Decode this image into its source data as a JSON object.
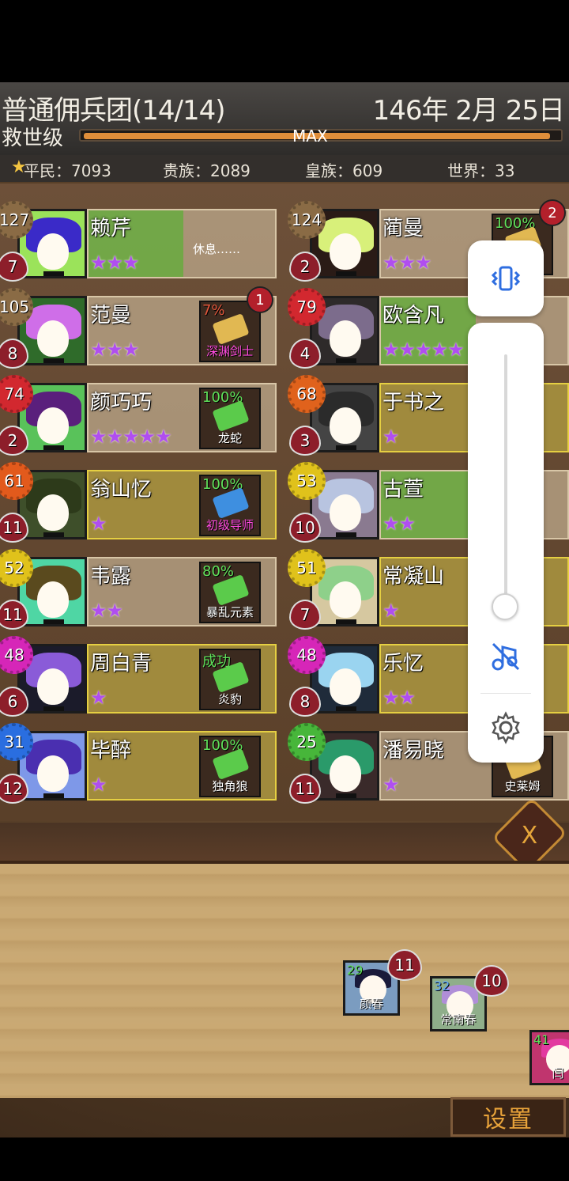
{
  "header": {
    "title": "普通佣兵团(14/14)",
    "date": "146年 2月 25日",
    "rank": "救世级",
    "xp_label": "MAX",
    "xp_fraction": 1.0
  },
  "stats": {
    "commoner": "平民：7093",
    "noble": "贵族：2089",
    "royal": "皇族：609",
    "world": "世界：33"
  },
  "roster_left": [
    {
      "name": "赖芹",
      "level": "127",
      "hp": "7",
      "stars": "★★★",
      "item": "",
      "item_pct": "",
      "rest": "休息……",
      "lvl_color": "#8a6b45",
      "hair": "#3a2ac8",
      "bg": "#9be35a",
      "highlight": true
    },
    {
      "name": "范曼",
      "level": "105",
      "hp": "8",
      "stars": "★★★",
      "item": "深渊剑士",
      "item_pct": "7%",
      "badge": "1",
      "lvl_color": "#8a6b45",
      "hair": "#cf6ee8",
      "bg": "#2f6b2a",
      "item_magenta": true
    },
    {
      "name": "颜巧巧",
      "level": "74",
      "hp": "2",
      "stars": "★★★★★",
      "item": "龙蛇",
      "item_pct": "100%",
      "lvl_color": "#d2282f",
      "hair": "#5a1f7c",
      "bg": "#59c25a"
    },
    {
      "name": "翁山忆",
      "level": "61",
      "hp": "11",
      "stars": "★",
      "item": "初级导师",
      "item_pct": "100%",
      "lvl_color": "#e25a1c",
      "hair": "#2d3a1a",
      "bg": "#3e4f2a",
      "item_magenta": true,
      "gold": true
    },
    {
      "name": "韦露",
      "level": "52",
      "hp": "11",
      "stars": "★★",
      "item": "暴乱元素",
      "item_pct": "80%",
      "lvl_color": "#e0c21b",
      "hair": "#5a4a1e",
      "bg": "#4fd6a4"
    },
    {
      "name": "周白青",
      "level": "48",
      "hp": "6",
      "stars": "★",
      "item": "炎豹",
      "item_pct": "成功",
      "lvl_color": "#d626b8",
      "hair": "#8a5bd8",
      "bg": "#1b1b2a",
      "gold": true
    },
    {
      "name": "毕醉",
      "level": "31",
      "hp": "12",
      "stars": "★",
      "item": "独角狼",
      "item_pct": "100%",
      "lvl_color": "#2a6ee0",
      "hair": "#4a2fb0",
      "bg": "#7e98e8",
      "gold": true
    }
  ],
  "roster_right": [
    {
      "name": "蔺曼",
      "level": "124",
      "hp": "2",
      "stars": "★★★",
      "item": "",
      "item_pct": "100%",
      "badge": "2",
      "lvl_color": "#8a6b45",
      "hair": "#d8f07a",
      "bg": "#2a1b16"
    },
    {
      "name": "欧含凡",
      "level": "79",
      "hp": "4",
      "stars": "★★★★★",
      "item": "",
      "item_pct": "",
      "lvl_color": "#d2282f",
      "hair": "#7c6c8c",
      "bg": "#2e2a2a",
      "highlight": true
    },
    {
      "name": "于书之",
      "level": "68",
      "hp": "3",
      "stars": "★",
      "item": "",
      "item_pct": "",
      "lvl_color": "#e0621c",
      "hair": "#2b2b2b",
      "bg": "#444",
      "gold": true
    },
    {
      "name": "古萱",
      "level": "53",
      "hp": "10",
      "stars": "★★",
      "item": "",
      "item_pct": "",
      "lvl_color": "#e0c21b",
      "hair": "#b8c4e0",
      "bg": "#8a7a90",
      "highlight": true
    },
    {
      "name": "常凝山",
      "level": "51",
      "hp": "7",
      "stars": "★",
      "item": "",
      "item_pct": "",
      "lvl_color": "#e0c21b",
      "hair": "#8ed08a",
      "bg": "#d6c8a0",
      "gold": true
    },
    {
      "name": "乐忆",
      "level": "48",
      "hp": "8",
      "stars": "★★",
      "item": "",
      "item_pct": "",
      "lvl_color": "#d626b8",
      "hair": "#9ad4f0",
      "bg": "#1f2b3a",
      "gold": true
    },
    {
      "name": "潘易晓",
      "level": "25",
      "hp": "11",
      "stars": "★",
      "item": "史莱姆",
      "item_pct": "",
      "lvl_color": "#47b63a",
      "hair": "#2a9a6a",
      "bg": "#3a2a2a"
    }
  ],
  "tray": [
    {
      "name": "颜春",
      "level": "29",
      "hp": "11",
      "hair": "#1a1a3a",
      "bg": "#7b9cc0"
    },
    {
      "name": "常南春",
      "level": "32",
      "hp": "10",
      "hair": "#b08ed8",
      "bg": "#8fae8a"
    },
    {
      "name": "闫",
      "level": "41",
      "hp": "",
      "hair": "#e23aa0",
      "bg": "#c0356e"
    }
  ],
  "buttons": {
    "settings": "设置",
    "close": "X"
  },
  "volume_overlay": {
    "level": 0.05,
    "icons": [
      "vibrate-icon",
      "music-muted-icon",
      "gear-icon"
    ]
  }
}
